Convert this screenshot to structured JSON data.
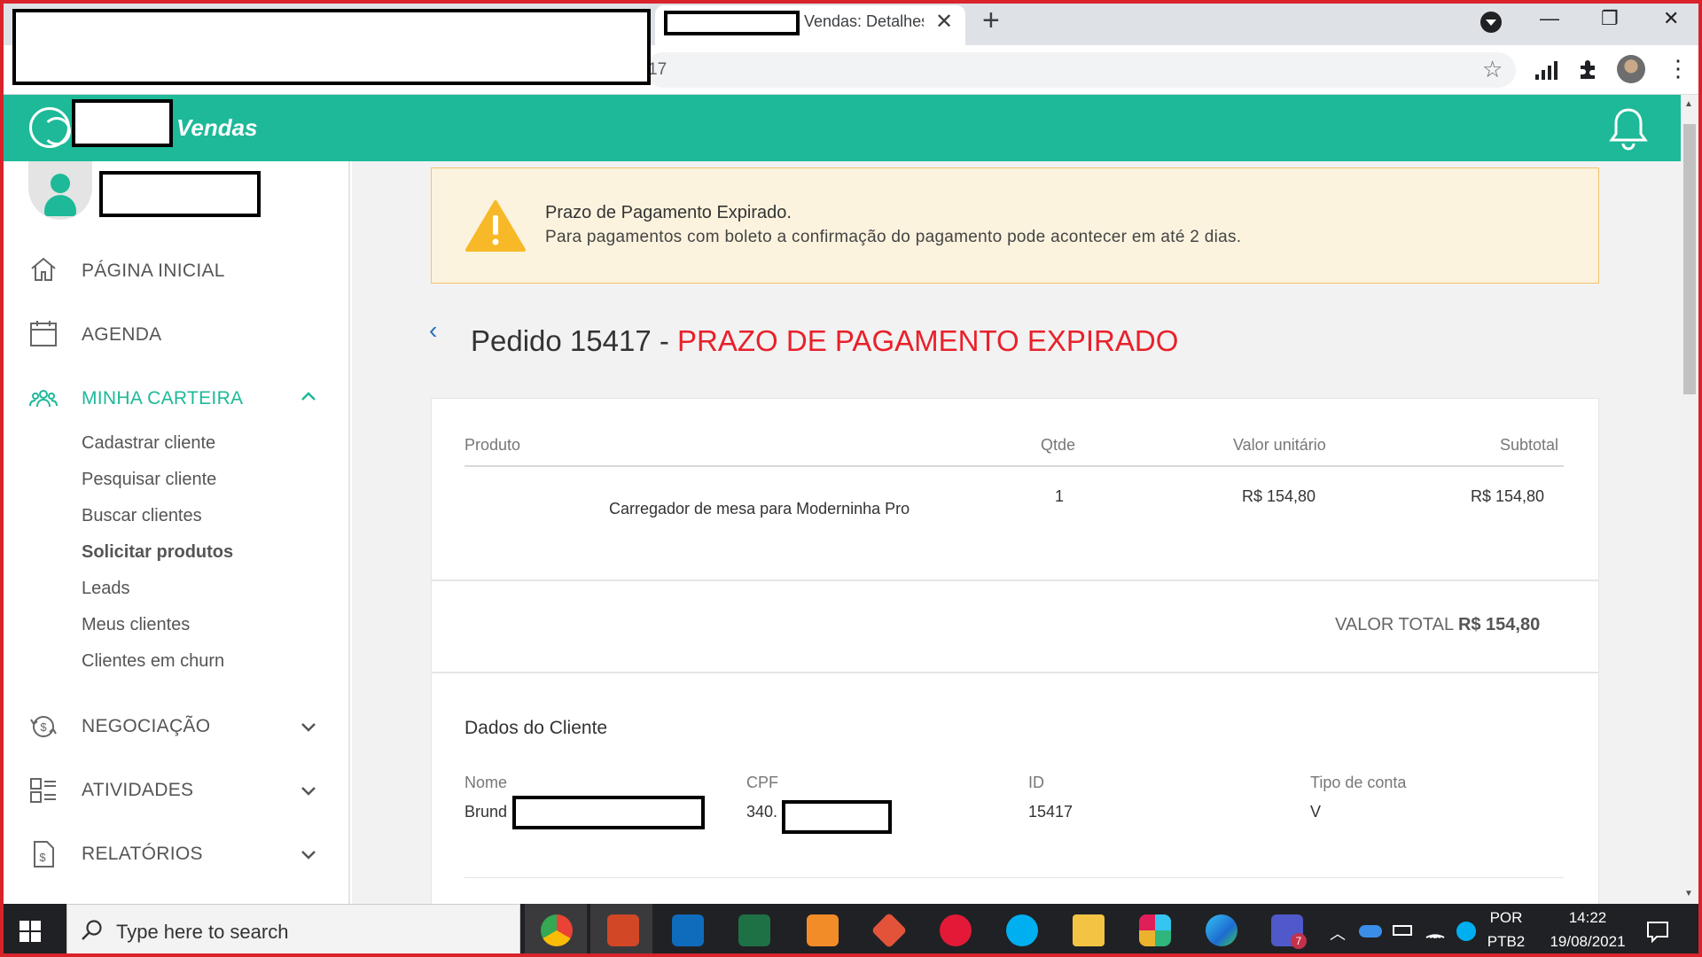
{
  "browser": {
    "tab_title": "Vendas: Detalhes",
    "tab_close": "✕",
    "new_tab": "+",
    "url_fragment": "17",
    "star": "☆",
    "minimize": "—",
    "restore": "❐",
    "close": "✕",
    "menu": "⋮"
  },
  "header": {
    "brand": "Vendas"
  },
  "sidebar": {
    "items": [
      {
        "label": "PÁGINA INICIAL",
        "icon": "home-icon"
      },
      {
        "label": "AGENDA",
        "icon": "calendar-icon"
      },
      {
        "label": "MINHA CARTEIRA",
        "icon": "people-icon",
        "active": true
      },
      {
        "label": "NEGOCIAÇÃO",
        "icon": "negotiation-icon"
      },
      {
        "label": "ATIVIDADES",
        "icon": "activities-icon"
      },
      {
        "label": "RELATÓRIOS",
        "icon": "reports-icon"
      }
    ],
    "subitems": [
      {
        "label": "Cadastrar cliente"
      },
      {
        "label": "Pesquisar cliente"
      },
      {
        "label": "Buscar clientes"
      },
      {
        "label": "Solicitar produtos"
      },
      {
        "label": "Leads"
      },
      {
        "label": "Meus clientes"
      },
      {
        "label": "Clientes em churn"
      }
    ]
  },
  "alert": {
    "title": "Prazo de Pagamento Expirado.",
    "text": "Para pagamentos com boleto a confirmação do pagamento pode acontecer em até 2 dias."
  },
  "page": {
    "back": "‹",
    "title": "Pedido 15417 - ",
    "status": "PRAZO DE PAGAMENTO EXPIRADO"
  },
  "order_table": {
    "headers": [
      "Produto",
      "Qtde",
      "Valor unitário",
      "Subtotal"
    ],
    "rows": [
      [
        "Carregador de mesa para Moderninha Pro",
        "1",
        "R$ 154,80",
        "R$ 154,80"
      ]
    ],
    "total_label": "VALOR TOTAL ",
    "total_value": "R$ 154,80"
  },
  "client": {
    "section_title": "Dados do Cliente",
    "headers": [
      "Nome",
      "CPF",
      "ID",
      "Tipo de conta"
    ],
    "values": [
      "Brund",
      "340.",
      "15417",
      "V"
    ]
  },
  "taskbar": {
    "search_placeholder": "Type here to search",
    "lang_top": "POR",
    "lang_bottom": "PTB2",
    "time": "14:22",
    "date": "19/08/2021",
    "teams_badge": "7"
  },
  "colors": {
    "brand": "#1db999",
    "status_red": "#e8212b",
    "alert_bg": "#fcf3de",
    "alert_border": "#f4c26c",
    "link_blue": "#2a6ebb"
  }
}
